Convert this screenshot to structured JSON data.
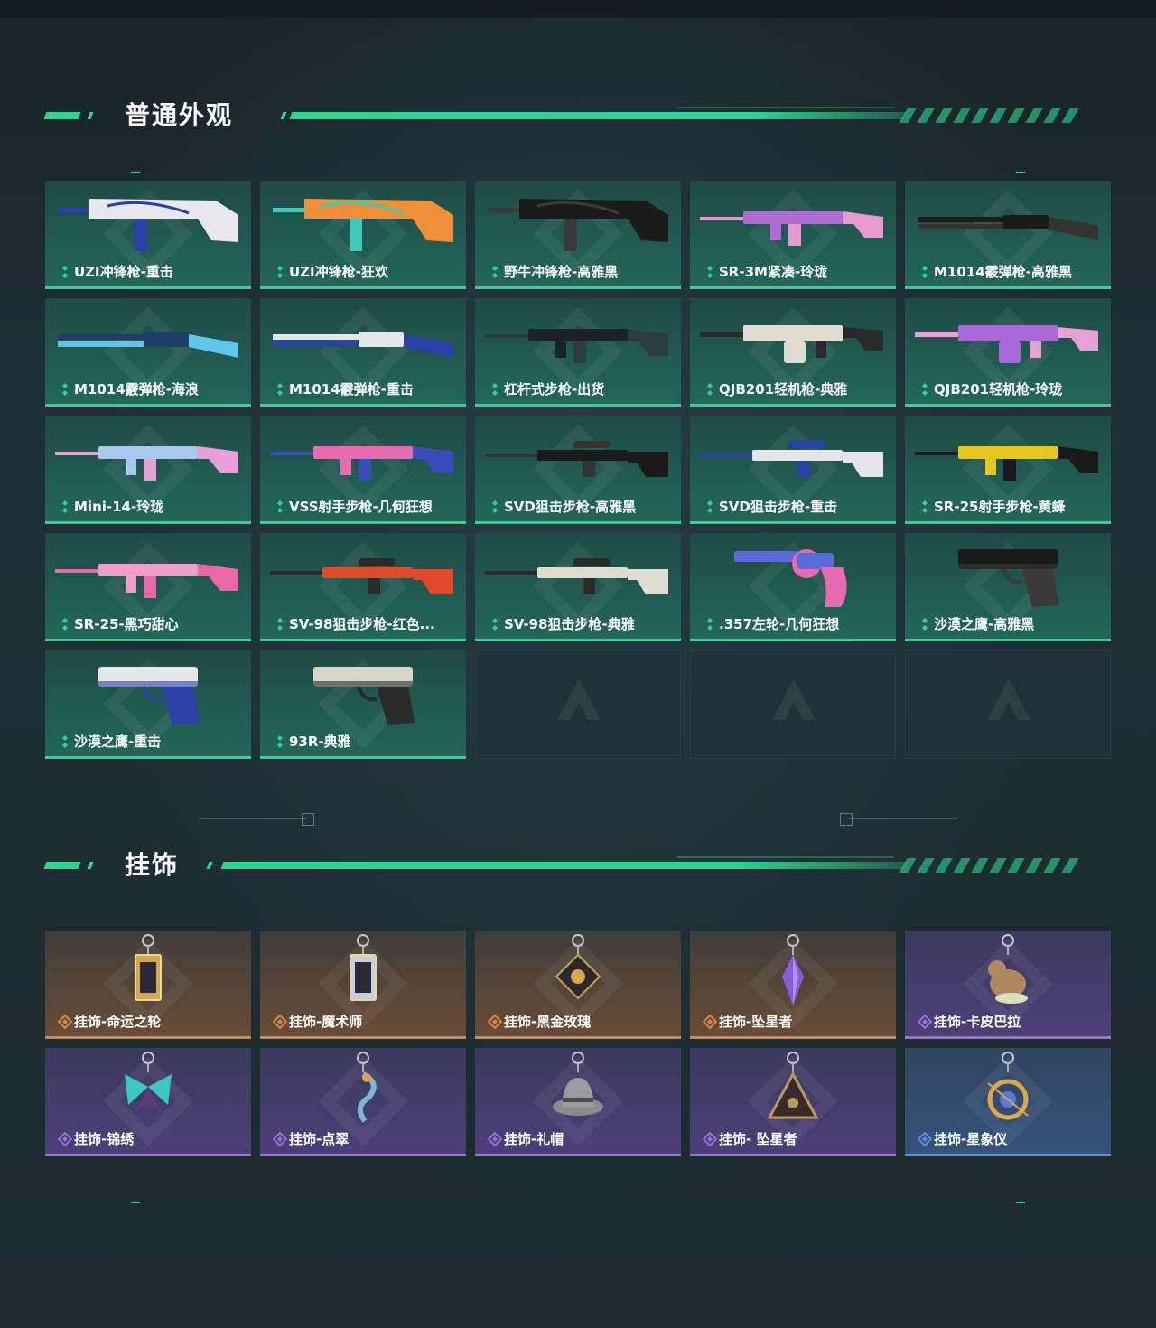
{
  "sections": {
    "weapons": {
      "title": "普通外观"
    },
    "charms": {
      "title": "挂饰"
    }
  },
  "colors": {
    "accent": "#2ed58f",
    "orange_rarity": "#d8874b",
    "purple_rarity": "#9a6fd8",
    "blue_rarity": "#5a8fd8"
  },
  "weapons": [
    {
      "label": "UZI冲锋枪-重击",
      "icon": "smg-icon",
      "c1": "#e8e8ee",
      "c2": "#2a3fa8"
    },
    {
      "label": "UZI冲锋枪-狂欢",
      "icon": "smg-icon",
      "c1": "#ef8f3a",
      "c2": "#3ec9b8"
    },
    {
      "label": "野牛冲锋枪-高雅黑",
      "icon": "smg-icon",
      "c1": "#1b1b1b",
      "c2": "#3a3a3a"
    },
    {
      "label": "SR-3M紧凑-玲珑",
      "icon": "rifle-icon",
      "c1": "#b06ad8",
      "c2": "#e89ad0"
    },
    {
      "label": "M1014霰弹枪-高雅黑",
      "icon": "shotgun-icon",
      "c1": "#1a1a1a",
      "c2": "#333333"
    },
    {
      "label": "M1014霰弹枪-海浪",
      "icon": "shotgun-icon",
      "c1": "#1f3f6a",
      "c2": "#5fc6e8"
    },
    {
      "label": "M1014霰弹枪-重击",
      "icon": "shotgun-icon",
      "c1": "#e6e6ea",
      "c2": "#2a3fa8"
    },
    {
      "label": "杠杆式步枪-出货",
      "icon": "rifle-icon",
      "c1": "#1a2226",
      "c2": "#2d3a3e"
    },
    {
      "label": "QJB201轻机枪-典雅",
      "icon": "lmg-icon",
      "c1": "#e0ddd0",
      "c2": "#2a2a2a"
    },
    {
      "label": "QJB201轻机枪-玲珑",
      "icon": "lmg-icon",
      "c1": "#a86ad8",
      "c2": "#e8a0d8"
    },
    {
      "label": "Mini-14-玲珑",
      "icon": "rifle-icon",
      "c1": "#a8c8f0",
      "c2": "#e8a0d8"
    },
    {
      "label": "VSS射手步枪-几何狂想",
      "icon": "rifle-icon",
      "c1": "#e86ab0",
      "c2": "#3a4ab8"
    },
    {
      "label": "SVD狙击步枪-高雅黑",
      "icon": "sniper-icon",
      "c1": "#1a1a1a",
      "c2": "#333333"
    },
    {
      "label": "SVD狙击步枪-重击",
      "icon": "sniper-icon",
      "c1": "#e6e6ea",
      "c2": "#2a3fa8"
    },
    {
      "label": "SR-25射手步枪-黄蜂",
      "icon": "rifle-icon",
      "c1": "#e8c81a",
      "c2": "#1a1a1a"
    },
    {
      "label": "SR-25-黑巧甜心",
      "icon": "rifle-icon",
      "c1": "#f0a0c8",
      "c2": "#e868a8"
    },
    {
      "label": "SV-98狙击步枪-红色...",
      "icon": "sniper-icon",
      "c1": "#e04a2a",
      "c2": "#2a2a2a"
    },
    {
      "label": "SV-98狙击步枪-典雅",
      "icon": "sniper-icon",
      "c1": "#e0ddd0",
      "c2": "#2a2a2a"
    },
    {
      "label": ".357左轮-几何狂想",
      "icon": "revolver-icon",
      "c1": "#5a6ad8",
      "c2": "#e86ab0"
    },
    {
      "label": "沙漠之鹰-高雅黑",
      "icon": "pistol-icon",
      "c1": "#1a1a1a",
      "c2": "#3a3a3a"
    },
    {
      "label": "沙漠之鹰-重击",
      "icon": "pistol-icon",
      "c1": "#e6e6ea",
      "c2": "#2a3fa8"
    },
    {
      "label": "93R-典雅",
      "icon": "pistol-icon",
      "c1": "#d8d4c6",
      "c2": "#2a2a2a"
    }
  ],
  "empty_slots": 3,
  "charms": [
    {
      "label": "挂饰-命运之轮",
      "rarity": "orange",
      "icon": "tarot-card-icon",
      "c1": "#d8a84b"
    },
    {
      "label": "挂饰-魔术师",
      "rarity": "orange",
      "icon": "tarot-card-icon",
      "c1": "#c8d0e0"
    },
    {
      "label": "挂饰-黑金玫瑰",
      "rarity": "orange",
      "icon": "rose-medallion-icon",
      "c1": "#2a2a2a"
    },
    {
      "label": "挂饰-坠星者",
      "rarity": "orange",
      "icon": "crystal-icon",
      "c1": "#8a5ad8"
    },
    {
      "label": "挂饰-卡皮巴拉",
      "rarity": "purple",
      "icon": "capybara-icon",
      "c1": "#b08860"
    },
    {
      "label": "挂饰-锦绣",
      "rarity": "purple",
      "icon": "butterfly-icon",
      "c1": "#3ac8c0"
    },
    {
      "label": "挂饰-点翠",
      "rarity": "purple",
      "icon": "phoenix-icon",
      "c1": "#7ab8d8"
    },
    {
      "label": "挂饰-礼帽",
      "rarity": "purple",
      "icon": "hat-icon",
      "c1": "#8a8a90"
    },
    {
      "label": "挂饰- 坠星者",
      "rarity": "purple",
      "icon": "triangle-eye-icon",
      "c1": "#b89a5a"
    },
    {
      "label": "挂饰-星象仪",
      "rarity": "blue",
      "icon": "astrolabe-icon",
      "c1": "#d8a84b"
    }
  ]
}
